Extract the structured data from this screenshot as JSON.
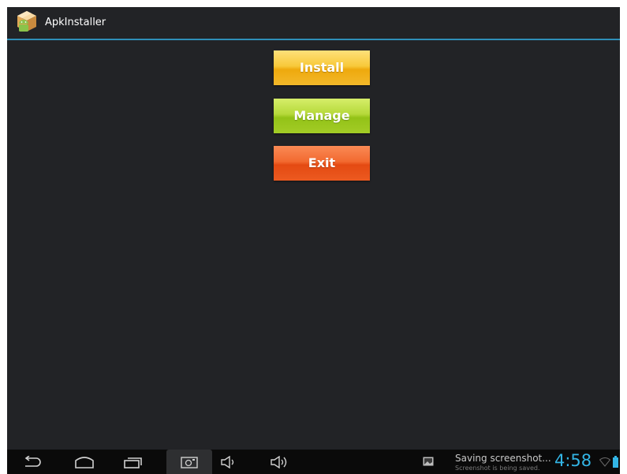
{
  "app": {
    "title": "ApkInstaller",
    "icon": "package-android-icon"
  },
  "buttons": {
    "install": {
      "label": "Install",
      "color": "#f5b81c"
    },
    "manage": {
      "label": "Manage",
      "color": "#a8cf2a"
    },
    "exit": {
      "label": "Exit",
      "color": "#ec5a20"
    }
  },
  "colors": {
    "background": "#222326",
    "action_bar_divider": "#2f8fb8",
    "clock": "#33b5e5"
  },
  "nav_bar": {
    "icons": [
      "back-icon",
      "home-icon",
      "recent-apps-icon",
      "screenshot-icon",
      "volume-down-icon",
      "volume-up-icon"
    ]
  },
  "status": {
    "notification_title": "Saving screenshot...",
    "notification_subtitle": "Screenshot is being saved.",
    "clock": "4:58"
  }
}
